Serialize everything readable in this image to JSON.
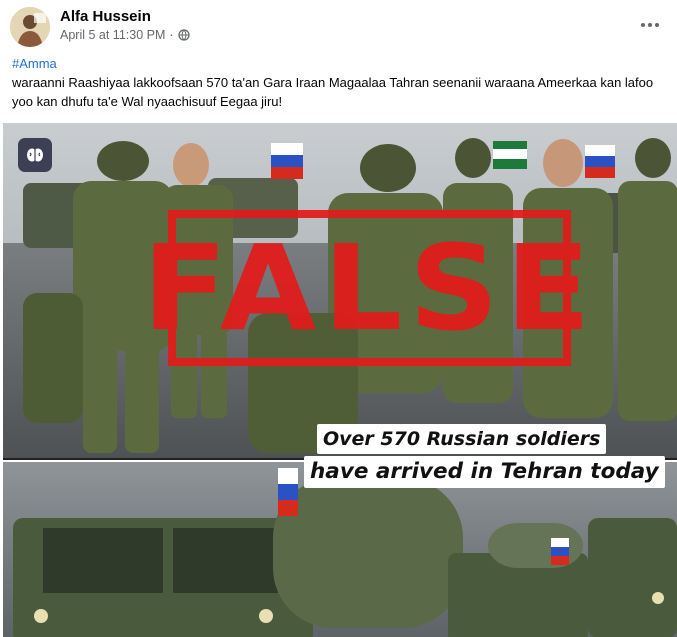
{
  "post": {
    "author": "Alfa Hussein",
    "timestamp": "April 5 at 11:30 PM",
    "separator": "·",
    "privacy_icon": "globe-icon",
    "more_icon": "more-options-icon",
    "hashtag": "#Amma",
    "text": "waraanni Raashiyaa lakkoofsaan 570 ta'an Gara Iraan Magaalaa Tahran seenanii waraana Ameerkaa kan lafoo yoo kan dhufu ta'e Wal nyaachisuuf Eegaa jiru!"
  },
  "image": {
    "stamp_text": "FALSE",
    "caption_line1": "Over 570 Russian soldiers",
    "caption_line2": "have arrived in Tehran today",
    "badge_icon": "brain-icon",
    "colors": {
      "stamp": "#e31b1b",
      "link": "#216fdb"
    }
  }
}
